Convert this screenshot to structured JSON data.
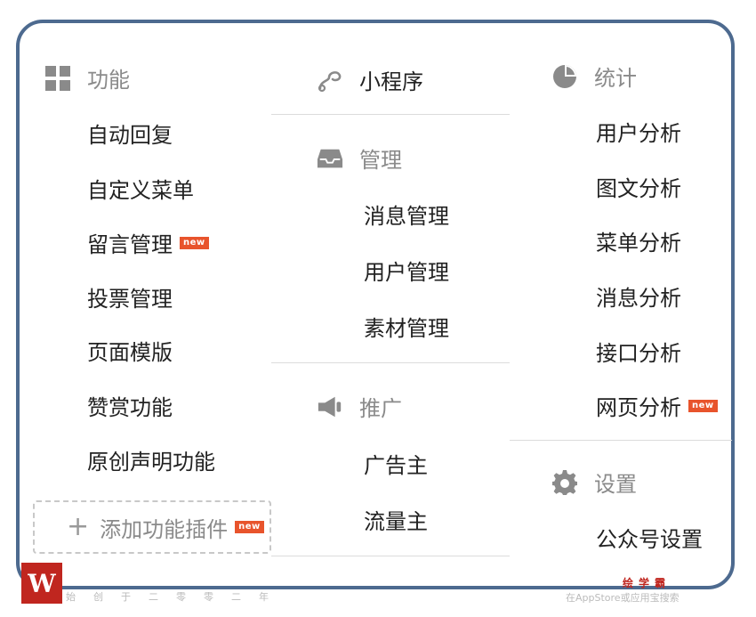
{
  "col1": {
    "heading": "功能",
    "items": [
      "自动回复",
      "自定义菜单",
      "留言管理",
      "投票管理",
      "页面模版",
      "赞赏功能",
      "原创声明功能"
    ],
    "badge": "new",
    "add_plugin": "添加功能插件"
  },
  "col2": {
    "miniprogram": "小程序",
    "manage": {
      "heading": "管理",
      "items": [
        "消息管理",
        "用户管理",
        "素材管理"
      ]
    },
    "promote": {
      "heading": "推广",
      "items": [
        "广告主",
        "流量主"
      ]
    }
  },
  "col3": {
    "stats": {
      "heading": "统计",
      "items": [
        "用户分析",
        "图文分析",
        "菜单分析",
        "消息分析",
        "接口分析",
        "网页分析"
      ]
    },
    "settings": {
      "heading": "设置",
      "items": [
        "公众号设置"
      ]
    }
  },
  "watermark": {
    "logo": "W",
    "left_text": "始创于二零零二年",
    "right_top": "绘学霸",
    "right_bottom": "在AppStore或应用宝搜索"
  },
  "colors": {
    "frame": "#4d6a8f",
    "badge": "#e8542c",
    "muted": "#8a8a8a"
  }
}
